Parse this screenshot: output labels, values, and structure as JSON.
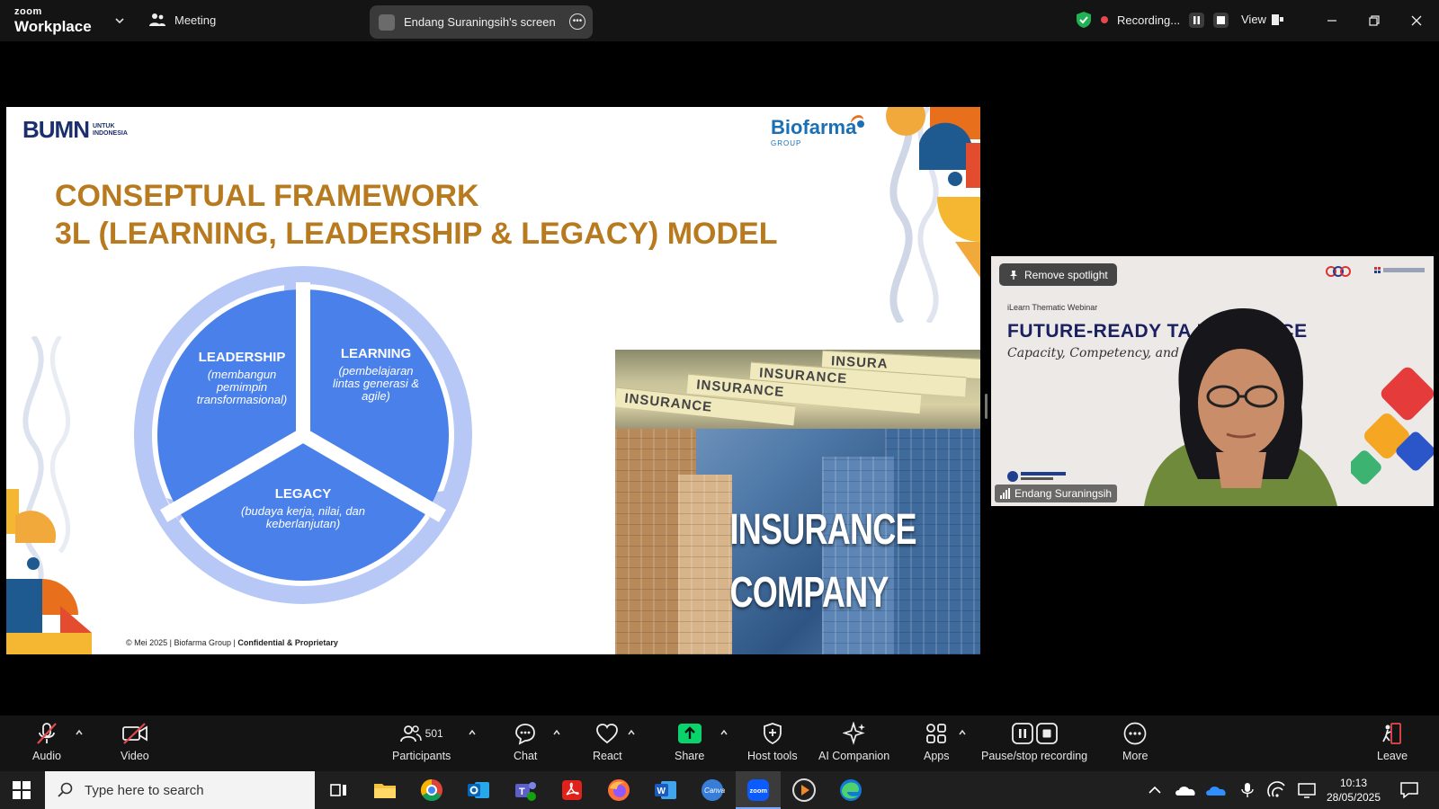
{
  "titlebar": {
    "brand_top": "zoom",
    "brand_bottom": "Workplace",
    "meeting_label": "Meeting",
    "screen_share_label": "Endang Suraningsih's screen",
    "recording_label": "Recording...",
    "view_label": "View"
  },
  "slide": {
    "bumn_logo": "BUMN",
    "bumn_sub_line1": "UNTUK",
    "bumn_sub_line2": "INDONESIA",
    "biofarma_name": "Biofarma",
    "biofarma_group": "GROUP",
    "title_line1": "CONSEPTUAL FRAMEWORK",
    "title_line2": "3L (LEARNING, LEADERSHIP & LEGACY) MODEL",
    "segments": [
      {
        "heading": "LEADERSHIP",
        "line1": "(membangun",
        "line2": "pemimpin",
        "line3": "transformasional)"
      },
      {
        "heading": "LEARNING",
        "line1": "(pembelajaran",
        "line2": "lintas generasi &",
        "line3": "agile)"
      },
      {
        "heading": "LEGACY",
        "line1": "(budaya kerja, nilai, dan",
        "line2": "keberlanjutan)"
      }
    ],
    "insurance_strips": [
      "INSURANCE",
      "INSURANCE",
      "INSURANCE",
      "INSURA"
    ],
    "insurance_company_line1": "INSURANCE",
    "insurance_company_line2": "COMPANY",
    "footer_prefix": "© Mei 2025 | Biofarma Group | ",
    "footer_bold": "Confidential & Proprietary"
  },
  "video": {
    "remove_spotlight_label": "Remove spotlight",
    "webinar_small": "iLearn Thematic Webinar",
    "webinar_title": "FUTURE-READY TA          NSURANCE",
    "webinar_script": "Capacity, Competency, and Culture",
    "participant_name": "Endang Suraningsih"
  },
  "toolbar": {
    "audio": "Audio",
    "video": "Video",
    "participants": "Participants",
    "participants_count": "501",
    "chat": "Chat",
    "react": "React",
    "share": "Share",
    "host_tools": "Host tools",
    "ai_companion": "AI Companion",
    "apps": "Apps",
    "pause_stop": "Pause/stop recording",
    "more": "More",
    "leave": "Leave"
  },
  "taskbar": {
    "search_placeholder": "Type here to search",
    "time": "10:13",
    "date": "28/05/2025"
  },
  "colors": {
    "accent_green": "#0bd36b",
    "slide_title": "#b87a1e",
    "cycle_blue": "#4a80ea",
    "cycle_ring": "#b7c8f7",
    "recording_red": "#e5484d"
  }
}
